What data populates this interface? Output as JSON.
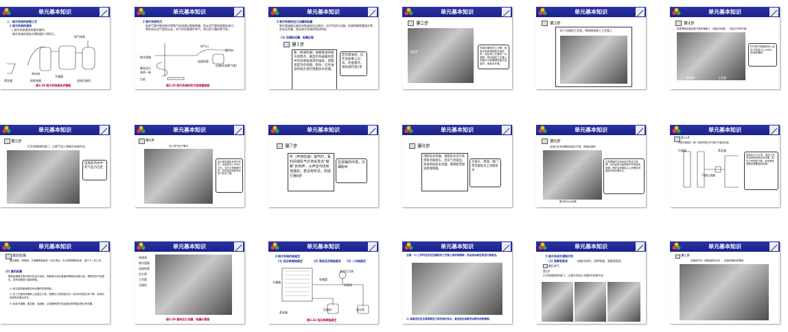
{
  "header_title": "单元基本知识",
  "colors": {
    "header": "#1b2287",
    "caption": "#b8003a",
    "heading": "#1a2a9a"
  },
  "icons": {
    "logo": "flower-logo-icon",
    "pen": "pen-icon"
  },
  "slides": [
    {
      "title": "单元基本知识",
      "lines": [
        "二、制冷系统的修理工艺",
        "1 制冷系统的清洗",
        "➢ 制冷系统清洗的基本操作。",
        "制冷系统的清洗步骤如图3.28所示。",
        "接气体瓶"
      ],
      "labels": [
        "蒸发器",
        "单向阀",
        "接收液器",
        "冷凝器",
        "连接压缩机"
      ],
      "caption": "图3.28 制冷系统清洗步骤图"
    },
    {
      "title": "单元基本知识",
      "lines": [
        "2 制冷系统吹污",
        "若吸气管中断的制冷管管气体流通过管路两端，再从回气管的接管处吸污，将杂质从回气管吹出去，吹污时向管路外吹气，然后用干燥的氮气吹。"
      ],
      "labels": [
        "排气口",
        "接气口",
        "制冷管路",
        "连接软管",
        "压缩机(或氮气瓶)",
        "需吸及打",
        "紧密一致",
        "白纸"
      ],
      "caption": "图3.29 制冷系统的吹污连接管路图"
    },
    {
      "title": "单元基本知识",
      "lines": [
        "3 制冷系统的压力试漏和检漏",
        "制冷管道被压缩机充氮或加压过高时，应尽早进行试漏，检查焊缝和管接头等处有无泄漏，保证制冷系统的密封性能。",
        "(1) 压缩机试漏、检漏过程"
      ],
      "step": "第1步",
      "box": "看（目测检漏）观察管道的接头和焊点，看是否有被氟利昂中的润滑油浸湿的油迹，或管道是否有划痕、裂纹，应有油迹的地方进行用肥皂水检漏。",
      "bubble": "若有漏油迹，应在该处做上记号，检查漏点，继续进行第2步"
    },
    {
      "title": "单元基本知识",
      "step": "第2步",
      "photo_label": "第2步",
      "bubble": "先取压缩机的工艺管，用扳手将修理阀的手柄关好，然后将工艺管的一头割断，将压缩机工艺管上的接头与修理阀的接头连接好，用扳手拧紧。"
    },
    {
      "title": "单元基本知识",
      "step": "第3步",
      "note": "拆下压缩机工艺管，将修理阀装上工艺管上"
    },
    {
      "title": "单元基本知识",
      "step": "第4步",
      "note": "将修理阀连接到氮气瓶的管路上（用高压软管），然后打开氮气瓶",
      "bubble": "拧开氮气瓶瓶阀充入至压力表显示1.2MPa，关闭修理阀",
      "labels": [
        "修理阀",
        "工艺管"
      ]
    },
    {
      "title": "单元基本知识",
      "step": "第5步",
      "note": "打开修理阀的阀门，让氮气充入到制冷系统中去",
      "bubble": "压缩机壳体中的气压力已足"
    },
    {
      "title": "单元基本知识",
      "step": "第6步",
      "note": "充入氮气至于管内",
      "bubble": "如大型压缩机系统中充气，应保持在1.5MPa左右，至压力表数据不变，然后检查系统中的压力有无下降"
    },
    {
      "title": "单元基本知识",
      "step": "第7步",
      "box": "听（声响检漏）漏气时，氟利昂或氮气外泄会发出“嘶嘶”的响声，从声音可找到泄漏处，若没有听见，则进行第8步",
      "bubble": "在安静的环境，仔细聆听"
    },
    {
      "title": "单元基本知识",
      "step": "第8步",
      "box": "用肥皂水检漏，将肥皂水涂于各焊接点和接头，若有气泡冒出，则说明该处有泄漏，需重新焊接或修理管路。",
      "bubble": "在接头、焊缝、阀门等可疑处涂上浓肥皂水"
    },
    {
      "title": "单元基本知识",
      "step": "第9步",
      "note": "若接头处有泄漏则将接头拧紧，焊接处重焊",
      "bubble": "注意焊接时先将系统中的压力放掉，否则容易引起焊接不牢而造成泄漏，焊好后再重复以上步骤检测直到不再泄漏为止。",
      "caption": "图中所示为检漏"
    },
    {
      "title": "单元基本知识",
      "step": "第10步",
      "note": "在制冷管路中（两一般的时候分压气管与气管的位置）",
      "labels": [
        "冷凝器",
        "蒸发器",
        "干燥过滤器"
      ],
      "bubble": "保持压力24小时，若压力无变化则说明系统无泄漏，若压力有明显下降，则说明有泄漏点需要重新检漏。"
    },
    {
      "title": "单元基本知识",
      "step": "最后检漏",
      "lines": [
        "看压缩机、修理阀、冷凝器等各部件一切正常后，可以把修理阀关闭，进行下一步工作。",
        "(2) 整机检漏",
        "整机检漏首先是对密封处进行检查，用肥皂水涂在管道的焊接处和接头处，看是否有气泡冒出，若有则要进行重新焊接。",
        "1) 用手感觉管道是否有泄漏的异常现象。",
        "2) 在工艺管的修理阀上连接压力表，观察压力表的指针在一定时间内是否有下降，若有则说明有泄漏点存在。",
        "3) 检查冷凝器、蒸发器、毛细管、过滤器等部件的连接处和焊接处是否有泄漏。"
      ]
    },
    {
      "title": "单元基本知识",
      "labels": [
        "修理阀",
        "制冷管路",
        "连接软管",
        "压力表",
        "工艺管",
        "压缩机"
      ],
      "caption": "图3.30 整体压力试漏、检漏示意图"
    },
    {
      "title": "单元基本知识",
      "lines": [
        "4 制冷系统的抽真空",
        "(1) 低压单侧抽真空",
        "(2) 高低压双侧抽真空",
        "(3) 二次抽真空"
      ],
      "labels": [
        "冷凝器",
        "毛细管",
        "真空压力表",
        "修理阀",
        "压缩机",
        "真空泵",
        "蒸发器"
      ],
      "caption": "图3.32 低压单侧抽真空"
    },
    {
      "title": "单元基本知识",
      "lines": [
        "注意：1) 工作时应先在压缩机的工艺管上接好修理阀，然后启动真空泵进行抽真空。",
        "2) 抽真空时应注意观察压力表的指针变化，真空度达到要求后再关闭修理阀。"
      ],
      "caption": "图中所示为抽真空"
    },
    {
      "title": "单元基本知识",
      "lines": [
        "5 制冷系统充灌制冷剂",
        "(1) 观察表直读",
        "加制冷剂时，用秤称量，观察表直读",
        "最后充气",
        "第1步",
        "打开修理阀的阀门，让制冷剂进入到制冷系统中去"
      ]
    },
    {
      "title": "单元基本知识",
      "step": "第1步",
      "note": "连接制冷剂（钢瓶装制冷剂），连接软管和修理阀"
    }
  ]
}
